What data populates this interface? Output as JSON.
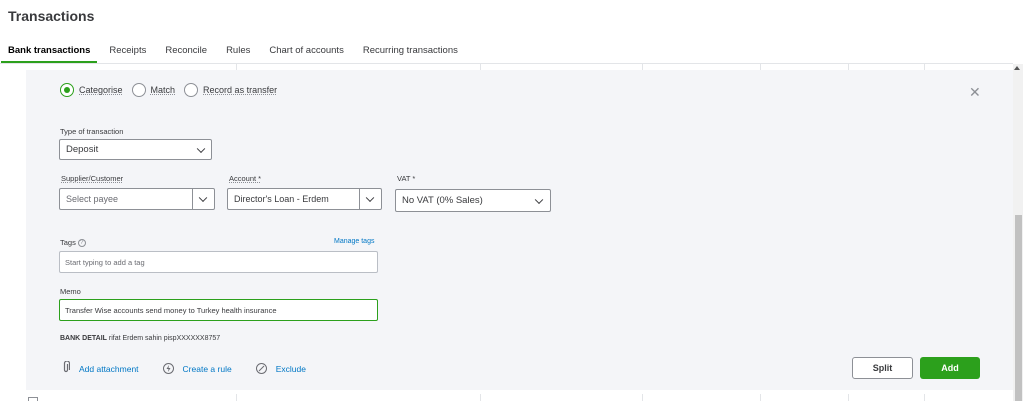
{
  "page": {
    "title": "Transactions"
  },
  "tabs": [
    {
      "label": "Bank transactions",
      "active": true
    },
    {
      "label": "Receipts"
    },
    {
      "label": "Reconcile"
    },
    {
      "label": "Rules"
    },
    {
      "label": "Chart of accounts"
    },
    {
      "label": "Recurring transactions"
    }
  ],
  "mode": {
    "selected": "Categorise",
    "options": [
      "Categorise",
      "Match",
      "Record as transfer"
    ]
  },
  "form": {
    "type_label": "Type of transaction",
    "type_value": "Deposit",
    "supplier_label": "Supplier/Customer",
    "supplier_placeholder": "Select payee",
    "account_label": "Account *",
    "account_value": "Director's Loan - Erdem",
    "vat_label": "VAT *",
    "vat_value": "No VAT (0% Sales)",
    "tags_label": "Tags",
    "manage_tags": "Manage tags",
    "tags_placeholder": "Start typing to add a tag",
    "memo_label": "Memo",
    "memo_value": "Transfer Wise accounts send money to Turkey health insurance"
  },
  "bank_detail": {
    "label": "BANK DETAIL",
    "value": "rifat Erdem sahin pispXXXXXX8757"
  },
  "actions": {
    "add_attachment": "Add attachment",
    "create_rule": "Create a rule",
    "exclude": "Exclude",
    "split": "Split",
    "add": "Add"
  },
  "colors": {
    "accent": "#2ca01c",
    "link": "#0077c5",
    "panel_bg": "#f4f5f8"
  },
  "icons": [
    "close-icon",
    "help-icon",
    "paperclip-icon",
    "lightning-icon",
    "prohibit-icon",
    "chevron-down-icon"
  ]
}
